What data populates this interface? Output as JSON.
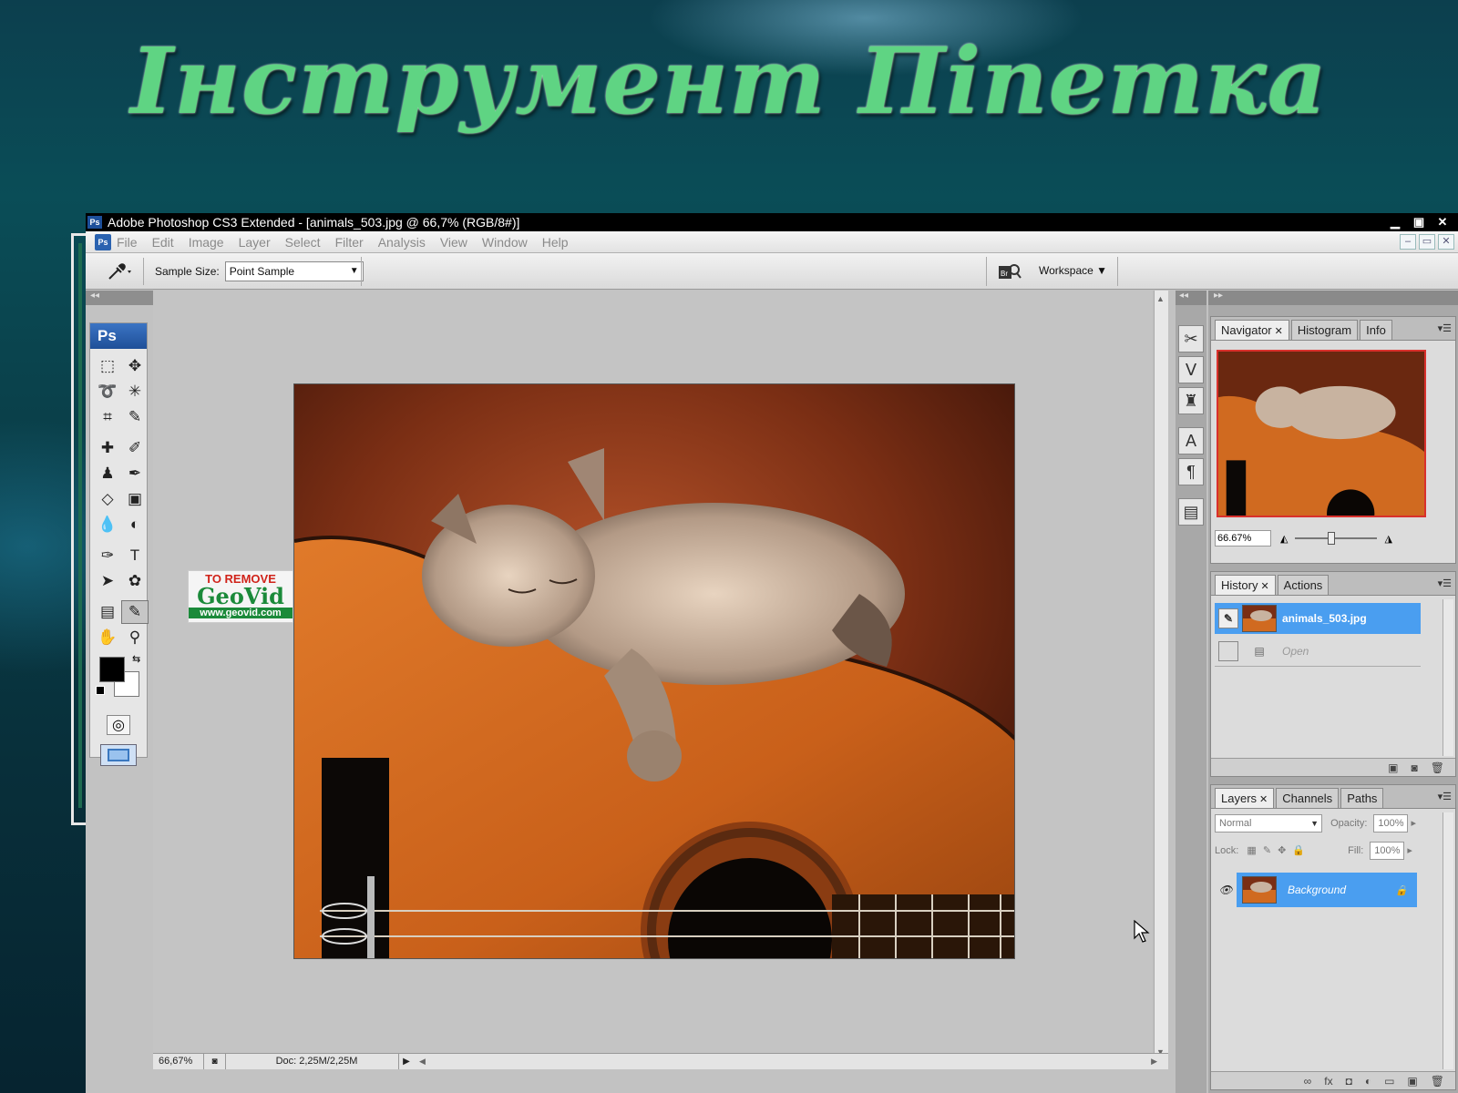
{
  "slide": {
    "title": "Інструмент Піпетка"
  },
  "window": {
    "title": "Adobe Photoshop CS3 Extended - [animals_503.jpg @ 66,7% (RGB/8#)]",
    "badge": "Ps",
    "controls": [
      "▁",
      "▣",
      "✕"
    ]
  },
  "menu": {
    "items": [
      "File",
      "Edit",
      "Image",
      "Layer",
      "Select",
      "Filter",
      "Analysis",
      "View",
      "Window",
      "Help"
    ],
    "logo": "Ps",
    "mdi": [
      "–",
      "▭",
      "✕"
    ]
  },
  "options": {
    "sample_size_label": "Sample Size:",
    "sample_size_value": "Point Sample",
    "workspace_label": "Workspace ▼",
    "bridge_icon": "Br"
  },
  "tools": {
    "header": "Ps"
  },
  "watermark": {
    "line1": "TO REMOVE",
    "line2": "GeoVid",
    "line3": "www.geovid.com"
  },
  "status": {
    "zoom": "66,67%",
    "doc": "Doc: 2,25M/2,25M"
  },
  "navigator": {
    "tabs": [
      "Navigator",
      "Histogram",
      "Info"
    ],
    "zoom": "66.67%"
  },
  "history": {
    "tabs": [
      "History",
      "Actions"
    ],
    "snapshot": "animals_503.jpg",
    "step": "Open"
  },
  "layers": {
    "tabs": [
      "Layers",
      "Channels",
      "Paths"
    ],
    "blend_mode": "Normal",
    "opacity_label": "Opacity:",
    "opacity": "100%",
    "lock_label": "Lock:",
    "fill_label": "Fill:",
    "fill": "100%",
    "layer_name": "Background"
  },
  "colors": {
    "selection": "#4a9ef0",
    "title_green": "#5fd483"
  }
}
